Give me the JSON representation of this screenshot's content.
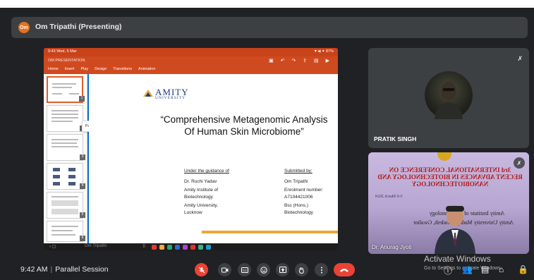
{
  "meeting": {
    "presenter_initials": "Om",
    "presenter_title": "Om Tripathi (Presenting)"
  },
  "shared_screen": {
    "status_time": "9:43 Wed, 5 Mar",
    "status_right": "▼◀ ✦ 87%",
    "app_title": "OM PRESENTATION",
    "ribbon_tabs": [
      "Home",
      "Insert",
      "Play",
      "Design",
      "Transitions",
      "Animation"
    ],
    "pane_tooltip": "Paste",
    "thumb_numbers": [
      "1",
      "2",
      "3",
      "4",
      "5",
      "6"
    ],
    "taskbar_name": "Om Tripathi",
    "slide": {
      "logo_text": "AMITY",
      "logo_sub": "UNIVERSITY",
      "title_line1": "“Comprehensive Metagenomic Analysis",
      "title_line2": "Of Human Skin Microbiome”",
      "left_heading": "Under the guidance of",
      "left_lines": [
        "Dr. Ruchi Yadav",
        "Amity Institute of",
        "Biotechnology",
        "Amity University,",
        "Lucknow"
      ],
      "right_heading": "Submitted by:",
      "right_lines": [
        "Om Tripathi",
        "Enrolment number:",
        "A7104421006",
        "Bsc (Hons.) Biotechnology"
      ],
      "page_number": "1"
    }
  },
  "participants": [
    {
      "name": "PRATIK SINGH"
    },
    {
      "name": "Dr. Anurag Jyoti"
    }
  ],
  "conference_poster": {
    "line1": "3rd INTERNATIONAL CONFERENCE ON",
    "line2": "RECENT ADVANCES IN BIOTECHNOLOGY AND",
    "line3": "NANOBIOTECHNOLOGY",
    "line4": "5-6 March 2024",
    "line5": "Amity Institute of Biotechnology",
    "line6": "Amity University Madhya Pradesh, Gwalior"
  },
  "watermark": {
    "title": "Activate Windows",
    "subtitle": "Go to Settings to activate Windows."
  },
  "footer": {
    "time": "9:42 AM",
    "separator": "|",
    "meeting_name": "Parallel Session"
  },
  "controls": {
    "mic": "mic-off-icon",
    "camera": "camera-icon",
    "captions": "cc-icon",
    "emoji": "emoji-icon",
    "present": "present-icon",
    "hand": "raise-hand-icon",
    "more": "more-vert-icon",
    "hangup": "call-end-icon",
    "accent_red": "#ea4335"
  }
}
